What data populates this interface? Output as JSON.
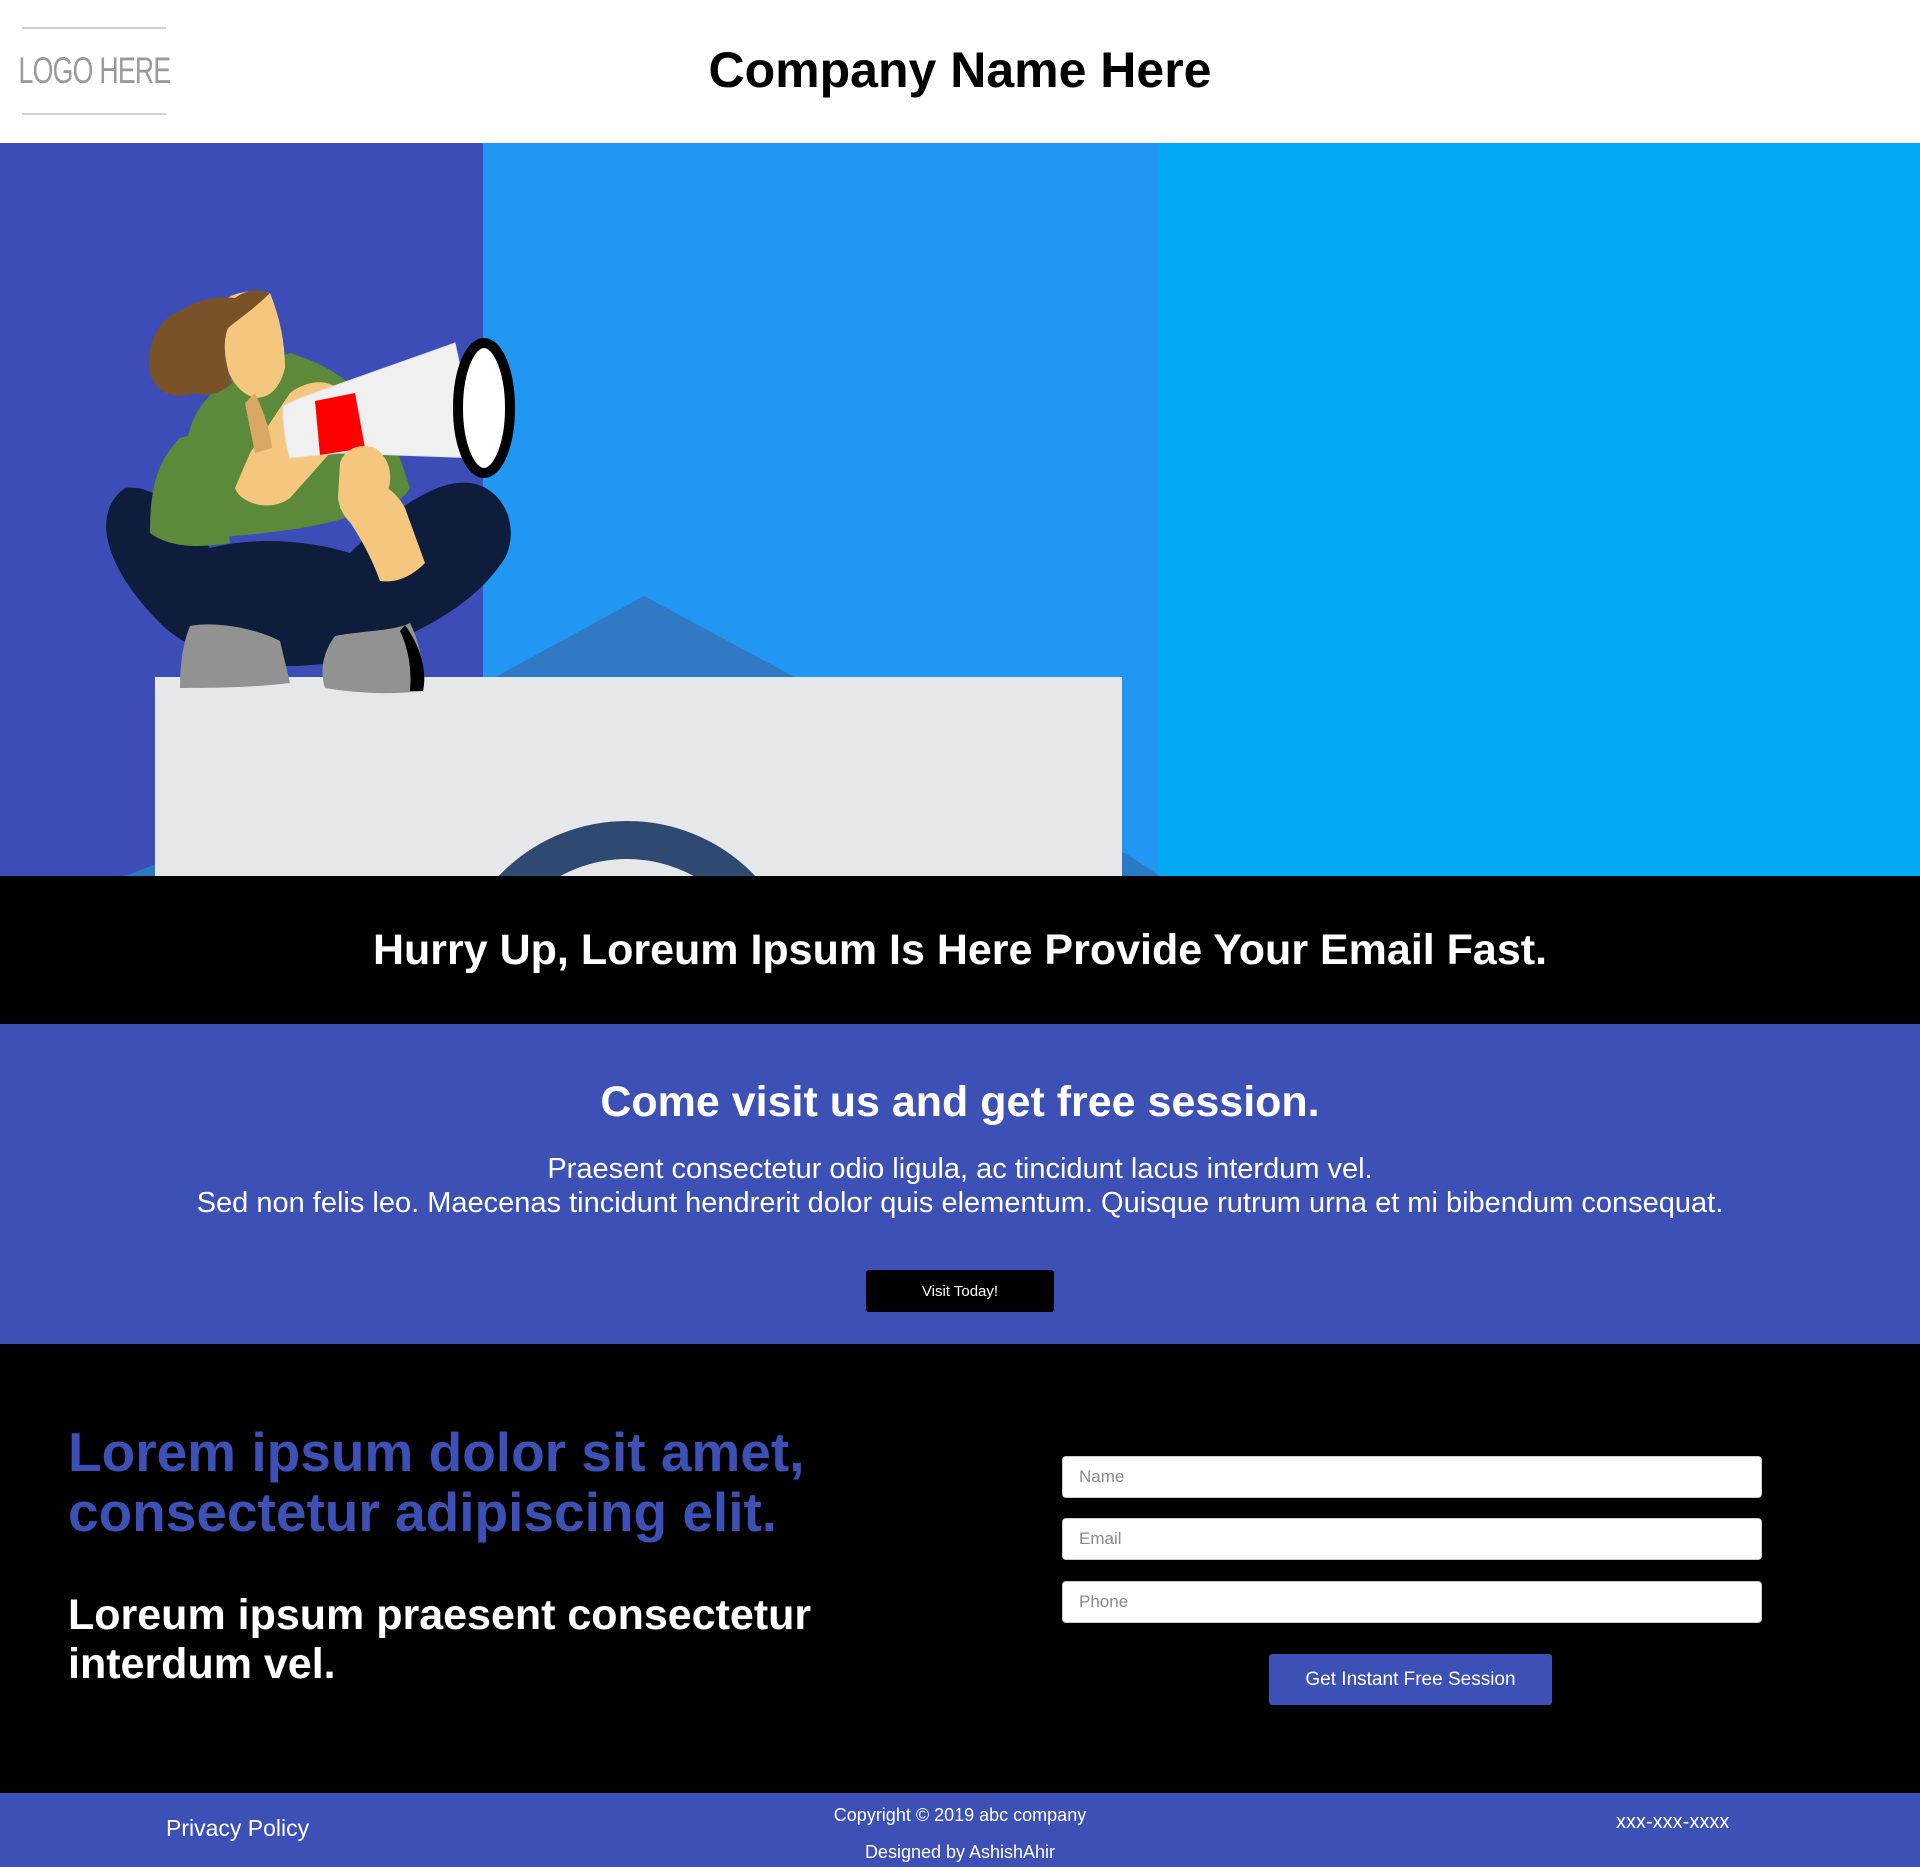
{
  "header": {
    "logo_text": "LOGO HERE",
    "company_name": "Company Name Here"
  },
  "hero": {
    "illustration": "man-with-megaphone-on-envelope",
    "colors": {
      "left": "#3d4db7",
      "middle": "#2196f3",
      "right": "#03a9f4"
    }
  },
  "banner": {
    "text": "Hurry Up, Loreum Ipsum Is Here Provide Your Email Fast."
  },
  "visit": {
    "title": "Come visit us and get free session.",
    "line1": "Praesent consectetur odio ligula, ac tincidunt lacus interdum vel.",
    "line2": "Sed non felis leo. Maecenas tincidunt hendrerit dolor quis elementum. Quisque rutrum urna et mi bibendum consequat.",
    "button_label": "Visit Today!"
  },
  "signup": {
    "headline": "Lorem ipsum dolor sit amet, consectetur adipiscing elit.",
    "subheadline": "Loreum ipsum praesent consectetur interdum vel.",
    "name_placeholder": "Name",
    "email_placeholder": "Email",
    "phone_placeholder": "Phone",
    "submit_label": "Get Instant Free Session"
  },
  "footer": {
    "privacy_label": "Privacy Policy",
    "copyright": "Copyright © 2019 abc company",
    "designed_by": "Designed by AshishAhir",
    "phone": "xxx-xxx-xxxx"
  },
  "theme": {
    "accent": "#3c50b5",
    "dark": "#000000"
  }
}
